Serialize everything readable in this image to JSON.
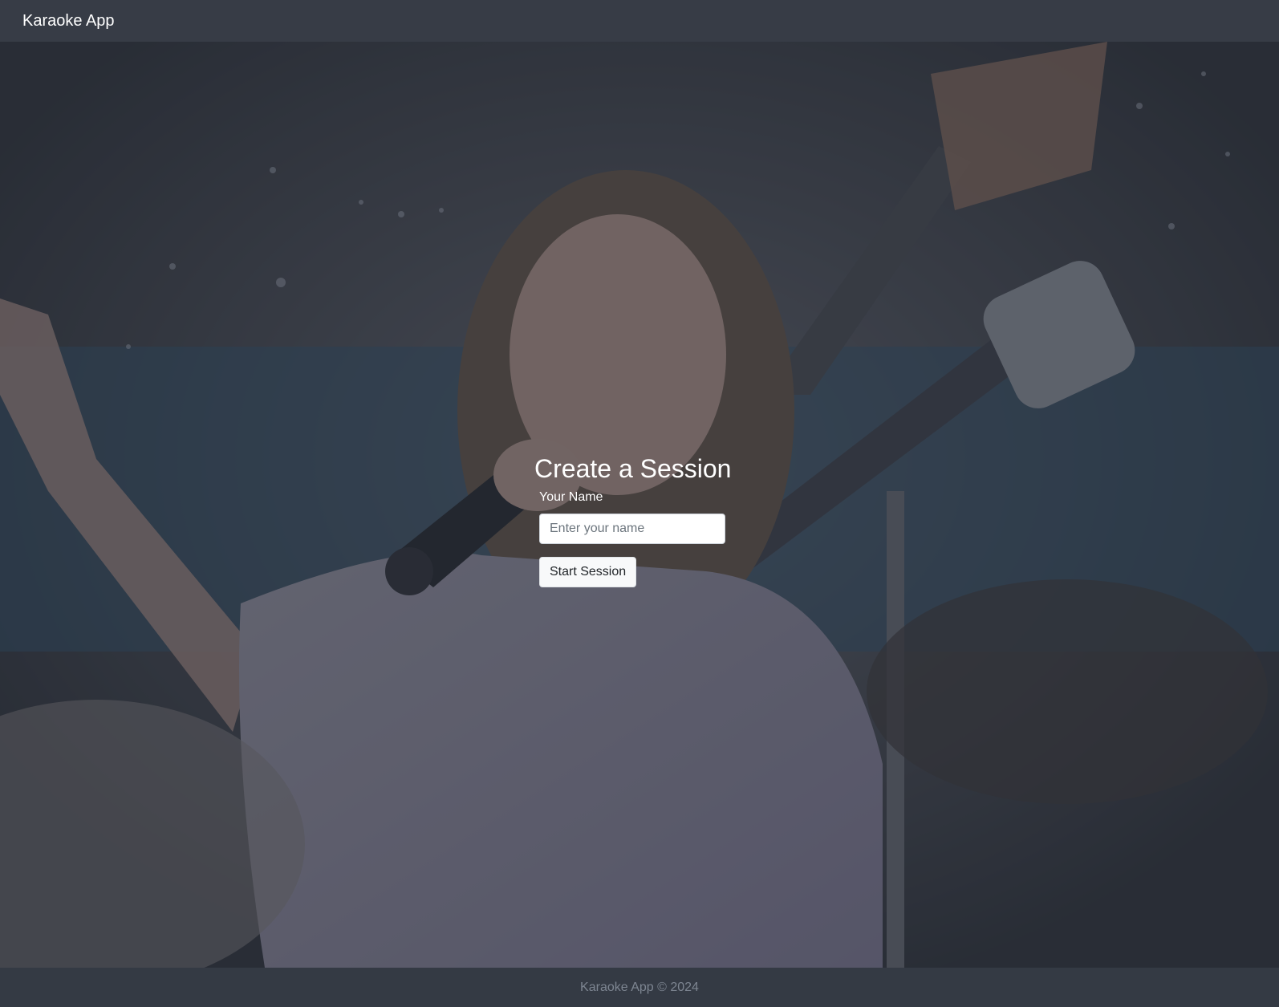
{
  "navbar": {
    "brand": "Karaoke App"
  },
  "hero": {
    "image_subject": "woman singing into a microphone with guitar"
  },
  "session_form": {
    "title": "Create a Session",
    "name_label": "Your Name",
    "name_placeholder": "Enter your name",
    "name_value": "",
    "submit_label": "Start Session"
  },
  "footer": {
    "text": "Karaoke App © 2024"
  },
  "colors": {
    "navbar_bg": "#373c46",
    "footer_bg": "#343a44",
    "footer_text": "#7d8591",
    "button_bg": "#f8f9fa"
  }
}
